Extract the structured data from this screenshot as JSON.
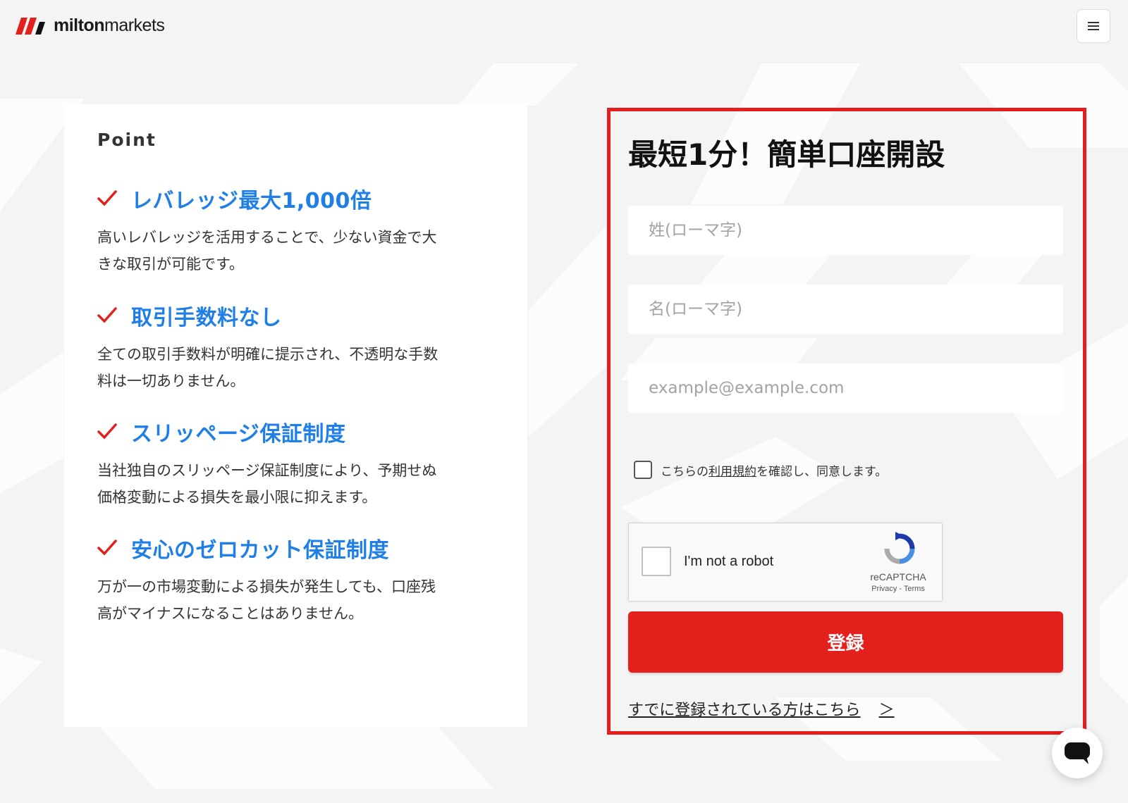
{
  "header": {
    "brand_bold": "milton",
    "brand_light": "markets",
    "menu_icon": "hamburger-menu-icon"
  },
  "points": {
    "heading": "Point",
    "items": [
      {
        "title": "レバレッジ最大1,000倍",
        "line1": "高いレバレッジを活用することで、少ない資金で大",
        "line2": "きな取引が可能です。"
      },
      {
        "title": "取引手数料なし",
        "line1": "全ての取引手数料が明確に提示され、不透明な手数",
        "line2": "料は一切ありません。"
      },
      {
        "title": "スリッページ保証制度",
        "line1": "当社独自のスリッページ保証制度により、予期せぬ",
        "line2": "価格変動による損失を最小限に抑えます。"
      },
      {
        "title": "安心のゼロカット保証制度",
        "line1": "万が一の市場変動による損失が発生しても、口座残",
        "line2": "高がマイナスになることはありません。"
      }
    ]
  },
  "form": {
    "title": "最短1分！簡単口座開設",
    "last_name_placeholder": "姓(ローマ字)",
    "first_name_placeholder": "名(ローマ字)",
    "email_placeholder": "example@example.com",
    "agree_prefix": "こちらの",
    "agree_link": "利用規約",
    "agree_suffix": "を確認し、同意します。",
    "recaptcha": {
      "label": "I'm not a robot",
      "brand": "reCAPTCHA",
      "privacy": "Privacy",
      "separator": " - ",
      "terms": "Terms"
    },
    "submit_label": "登録",
    "login_text": "すでに登録されている方はこちら",
    "login_arrow": "＞"
  },
  "colors": {
    "accent_red": "#e4201c",
    "frame_red": "#e71c1c",
    "feature_blue": "#1f7fe6",
    "background": "#f4f4f4"
  }
}
